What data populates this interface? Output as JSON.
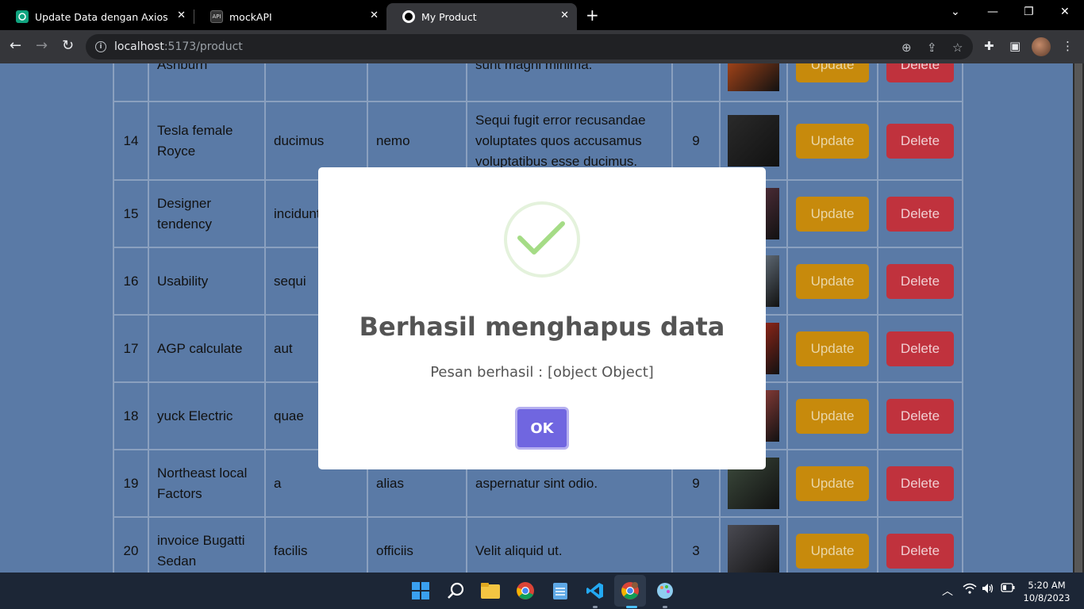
{
  "browser": {
    "tabs": [
      {
        "title": "Update Data dengan Axios",
        "icon": "chatgpt-icon"
      },
      {
        "title": "mockAPI",
        "icon": "mockapi-icon"
      },
      {
        "title": "My Product",
        "icon": "github-icon",
        "active": true
      }
    ],
    "url_host": "localhost",
    "url_rest": ":5173/product"
  },
  "table": {
    "rows": [
      {
        "no": "",
        "name": "Ashburn",
        "col_a": "",
        "col_b": "",
        "desc": "sunt magni minima.",
        "qty": "",
        "img_color": "#c8501a"
      },
      {
        "no": "14",
        "name": "Tesla female Royce",
        "col_a": "ducimus",
        "col_b": "nemo",
        "desc": "Sequi fugit error recusandae voluptates quos accusamus voluptatibus esse ducimus.",
        "qty": "9",
        "img_color": "#2a2a2a"
      },
      {
        "no": "15",
        "name": "Designer tendency",
        "col_a": "incidunt",
        "col_b": "",
        "desc": "",
        "qty": "",
        "img_color": "#6a3a4a"
      },
      {
        "no": "16",
        "name": "Usability",
        "col_a": "sequi",
        "col_b": "",
        "desc": "",
        "qty": "",
        "img_color": "#8899aa"
      },
      {
        "no": "17",
        "name": "AGP calculate",
        "col_a": "aut",
        "col_b": "",
        "desc": "",
        "qty": "",
        "img_color": "#d0301c"
      },
      {
        "no": "18",
        "name": "yuck Electric",
        "col_a": "quae",
        "col_b": "",
        "desc": "",
        "qty": "",
        "img_color": "#c0504a"
      },
      {
        "no": "19",
        "name": "Northeast local Factors",
        "col_a": "a",
        "col_b": "alias",
        "desc": "aspernatur sint odio.",
        "qty": "9",
        "img_color": "#3c4a3c"
      },
      {
        "no": "20",
        "name": "invoice Bugatti Sedan",
        "col_a": "facilis",
        "col_b": "officiis",
        "desc": "Velit aliquid ut.",
        "qty": "3",
        "img_color": "#4a4a52"
      }
    ],
    "update_label": "Update",
    "delete_label": "Delete"
  },
  "modal": {
    "title": "Berhasil menghapus data",
    "message": "Pesan berhasil : [object Object]",
    "ok_label": "OK",
    "icon": "success-check-icon"
  },
  "taskbar": {
    "time": "5:20 AM",
    "date": "10/8/2023"
  }
}
